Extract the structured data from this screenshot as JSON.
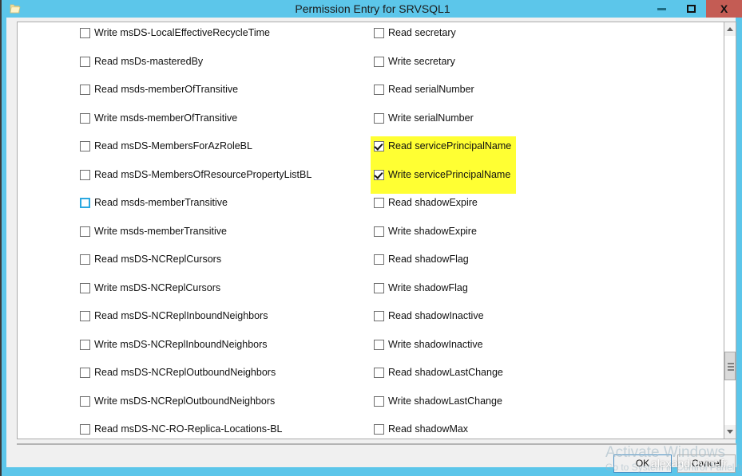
{
  "window": {
    "title": "Permission Entry for SRVSQL1",
    "icon": "folder-icon",
    "minimize_label": "–",
    "maximize_label": "□",
    "close_label": "X",
    "accent_color": "#5cc6ea",
    "close_color": "#c45c54",
    "highlight_color": "#ffff33"
  },
  "permissions": {
    "left_column": [
      {
        "label": "Write msDS-LocalEffectiveRecycleTime",
        "checked": false,
        "hover": false,
        "highlighted": false
      },
      {
        "label": "Read msDs-masteredBy",
        "checked": false,
        "hover": false,
        "highlighted": false
      },
      {
        "label": "Read msds-memberOfTransitive",
        "checked": false,
        "hover": false,
        "highlighted": false
      },
      {
        "label": "Write msds-memberOfTransitive",
        "checked": false,
        "hover": false,
        "highlighted": false
      },
      {
        "label": "Read msDS-MembersForAzRoleBL",
        "checked": false,
        "hover": false,
        "highlighted": false
      },
      {
        "label": "Read msDS-MembersOfResourcePropertyListBL",
        "checked": false,
        "hover": false,
        "highlighted": false
      },
      {
        "label": "Read msds-memberTransitive",
        "checked": false,
        "hover": true,
        "highlighted": false
      },
      {
        "label": "Write msds-memberTransitive",
        "checked": false,
        "hover": false,
        "highlighted": false
      },
      {
        "label": "Read msDS-NCReplCursors",
        "checked": false,
        "hover": false,
        "highlighted": false
      },
      {
        "label": "Write msDS-NCReplCursors",
        "checked": false,
        "hover": false,
        "highlighted": false
      },
      {
        "label": "Read msDS-NCReplInboundNeighbors",
        "checked": false,
        "hover": false,
        "highlighted": false
      },
      {
        "label": "Write msDS-NCReplInboundNeighbors",
        "checked": false,
        "hover": false,
        "highlighted": false
      },
      {
        "label": "Read msDS-NCReplOutboundNeighbors",
        "checked": false,
        "hover": false,
        "highlighted": false
      },
      {
        "label": "Write msDS-NCReplOutboundNeighbors",
        "checked": false,
        "hover": false,
        "highlighted": false
      },
      {
        "label": "Read msDS-NC-RO-Replica-Locations-BL",
        "checked": false,
        "hover": false,
        "highlighted": false
      }
    ],
    "right_column": [
      {
        "label": "Read secretary",
        "checked": false,
        "hover": false,
        "highlighted": false
      },
      {
        "label": "Write secretary",
        "checked": false,
        "hover": false,
        "highlighted": false
      },
      {
        "label": "Read serialNumber",
        "checked": false,
        "hover": false,
        "highlighted": false
      },
      {
        "label": "Write serialNumber",
        "checked": false,
        "hover": false,
        "highlighted": false
      },
      {
        "label": "Read servicePrincipalName",
        "checked": true,
        "hover": false,
        "highlighted": true
      },
      {
        "label": "Write servicePrincipalName",
        "checked": true,
        "hover": false,
        "highlighted": true
      },
      {
        "label": "Read shadowExpire",
        "checked": false,
        "hover": false,
        "highlighted": false
      },
      {
        "label": "Write shadowExpire",
        "checked": false,
        "hover": false,
        "highlighted": false
      },
      {
        "label": "Read shadowFlag",
        "checked": false,
        "hover": false,
        "highlighted": false
      },
      {
        "label": "Write shadowFlag",
        "checked": false,
        "hover": false,
        "highlighted": false
      },
      {
        "label": "Read shadowInactive",
        "checked": false,
        "hover": false,
        "highlighted": false
      },
      {
        "label": "Write shadowInactive",
        "checked": false,
        "hover": false,
        "highlighted": false
      },
      {
        "label": "Read shadowLastChange",
        "checked": false,
        "hover": false,
        "highlighted": false
      },
      {
        "label": "Write shadowLastChange",
        "checked": false,
        "hover": false,
        "highlighted": false
      },
      {
        "label": "Read shadowMax",
        "checked": false,
        "hover": false,
        "highlighted": false
      }
    ]
  },
  "footer": {
    "ok_label": "OK",
    "cancel_label": "Cancel"
  },
  "watermarks": {
    "activate_line1": "Activate Windows",
    "activate_line2": "Go to System in Control Panel to activate Windows.",
    "site": "alexandreviot.fr"
  },
  "scrollbar": {
    "up_arrow": "scroll-up-arrow",
    "down_arrow": "scroll-down-arrow"
  }
}
